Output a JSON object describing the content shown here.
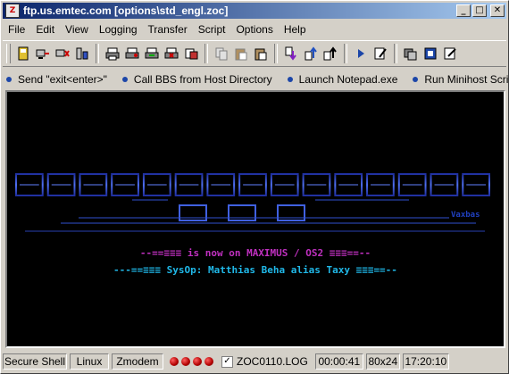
{
  "window": {
    "title": "ftp.us.emtec.com [options\\std_engl.zoc]",
    "app_icon": "zoc-icon"
  },
  "window_buttons": {
    "minimize": "_",
    "maximize": "□",
    "close": "✕"
  },
  "menu": [
    "File",
    "Edit",
    "View",
    "Logging",
    "Transfer",
    "Script",
    "Options",
    "Help"
  ],
  "toolbar": {
    "icons": [
      "address-book-icon",
      "connect-icon",
      "disconnect-icon",
      "hosts-icon",
      "print-icon",
      "print-setup-icon",
      "capture-icon",
      "close-capture-icon",
      "log-icon",
      "copy-icon",
      "paste-icon",
      "paste-special-icon",
      "download-icon",
      "upload-icon",
      "upload-multi-icon",
      "run-script-icon",
      "edit-script-icon",
      "session-options-icon",
      "program-options-icon",
      "edit-options-icon"
    ]
  },
  "macros": [
    {
      "label": "Send \"exit<enter>\""
    },
    {
      "label": "Call BBS from Host Directory"
    },
    {
      "label": "Launch Notepad.exe"
    },
    {
      "label": "Run Minihost Script"
    }
  ],
  "terminal": {
    "logo_text": "MOONLIGHT TUNING",
    "logo_sub": "BBS",
    "signature": "Vaxbas",
    "line1": "--==≡≡≡ is now on MAXIMUS / OS2 ≡≡≡==--",
    "line2": "---==≡≡≡ SysOp: Matthias Beha alias Taxy ≡≡≡==--",
    "colors": {
      "logo": "#3048d0",
      "line1": "#c030c0",
      "line2": "#20b8e8",
      "background": "#000000"
    }
  },
  "status": {
    "connection": "Secure Shell",
    "emulation": "Linux",
    "transfer": "Zmodem",
    "led_count": 4,
    "log_checked": true,
    "log_file": "ZOC0110.LOG",
    "online_time": "00:00:41",
    "screen_size": "80x24",
    "clock": "17:20:10"
  }
}
